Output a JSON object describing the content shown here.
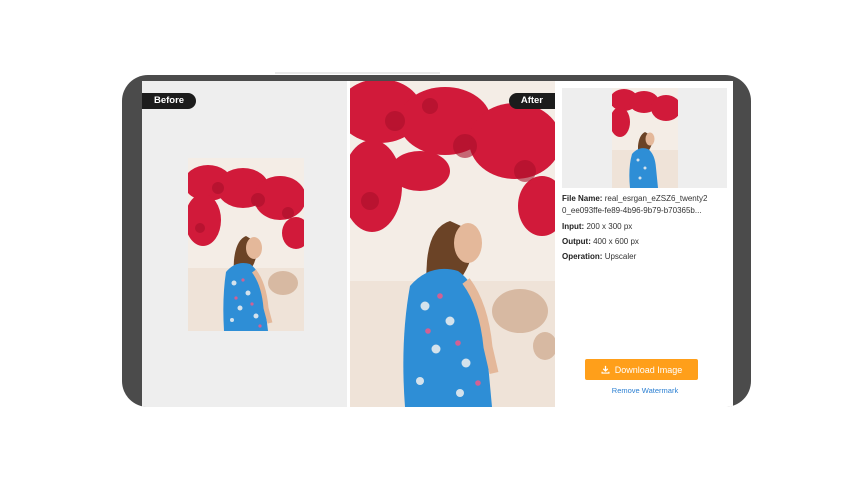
{
  "labels": {
    "before": "Before",
    "after": "After"
  },
  "info": {
    "file_name_label": "File Name:",
    "file_name_line1": "real_esrgan_eZSZ6_twenty2",
    "file_name_line2": "0_ee093ffe-fe89-4b96-9b79-b70365b...",
    "input_label": "Input:",
    "input_value": "200 x 300 px",
    "output_label": "Output:",
    "output_value": "400 x 600 px",
    "operation_label": "Operation:",
    "operation_value": "Upscaler"
  },
  "actions": {
    "download_label": "Download Image",
    "remove_watermark_label": "Remove Watermark"
  },
  "icons": {
    "download": "download-icon"
  },
  "colors": {
    "accent": "#ff9f1a",
    "link": "#2b7fd2",
    "frame": "#4b4b4b",
    "pill": "#1c1c1c"
  }
}
